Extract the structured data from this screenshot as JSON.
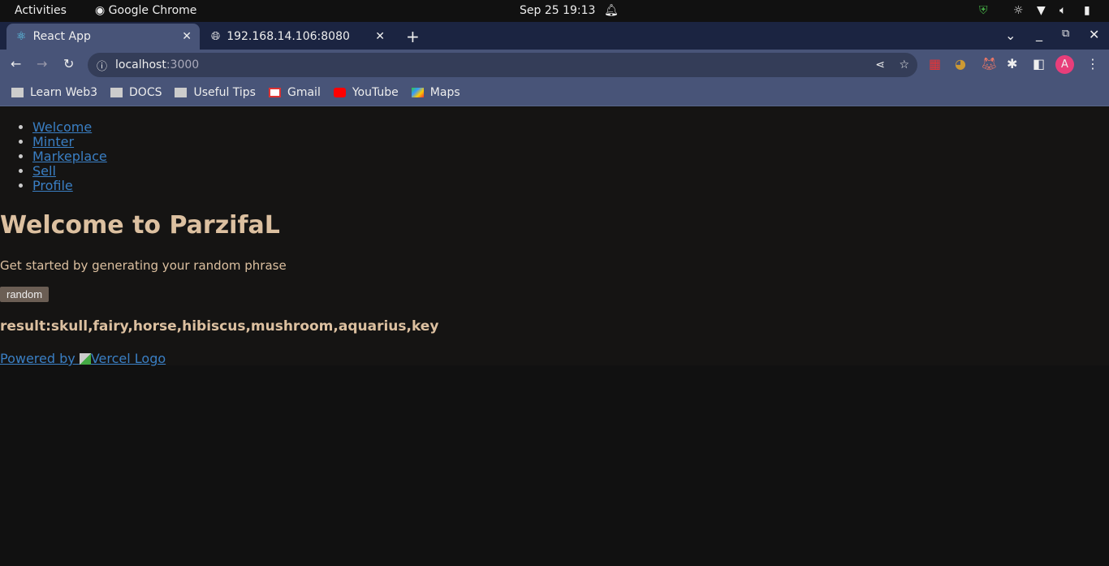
{
  "system": {
    "activities": "Activities",
    "app": "Google Chrome",
    "datetime": "Sep 25  19:13"
  },
  "tabs": [
    {
      "label": "React App",
      "icon": "react-icon"
    },
    {
      "label": "192.168.14.106:8080",
      "icon": "globe-icon"
    }
  ],
  "address": {
    "host": "localhost",
    "port": ":3000"
  },
  "bookmarks": [
    {
      "label": "Learn Web3",
      "icon": "folder-icon"
    },
    {
      "label": "DOCS",
      "icon": "folder-icon"
    },
    {
      "label": "Useful Tips",
      "icon": "folder-icon"
    },
    {
      "label": "Gmail",
      "icon": "gmail-icon"
    },
    {
      "label": "YouTube",
      "icon": "youtube-icon"
    },
    {
      "label": "Maps",
      "icon": "maps-icon"
    }
  ],
  "profile_initial": "A",
  "nav": [
    "Welcome",
    "Minter",
    "Markeplace",
    "Sell",
    "Profile"
  ],
  "main": {
    "title": "Welcome to ParzifaL",
    "subtitle": "Get started by generating your random phrase",
    "button": "random",
    "result": "result:skull,fairy,horse,hibiscus,mushroom,aquarius,key",
    "powered": "Powered by ",
    "logo_alt": "Vercel Logo"
  }
}
